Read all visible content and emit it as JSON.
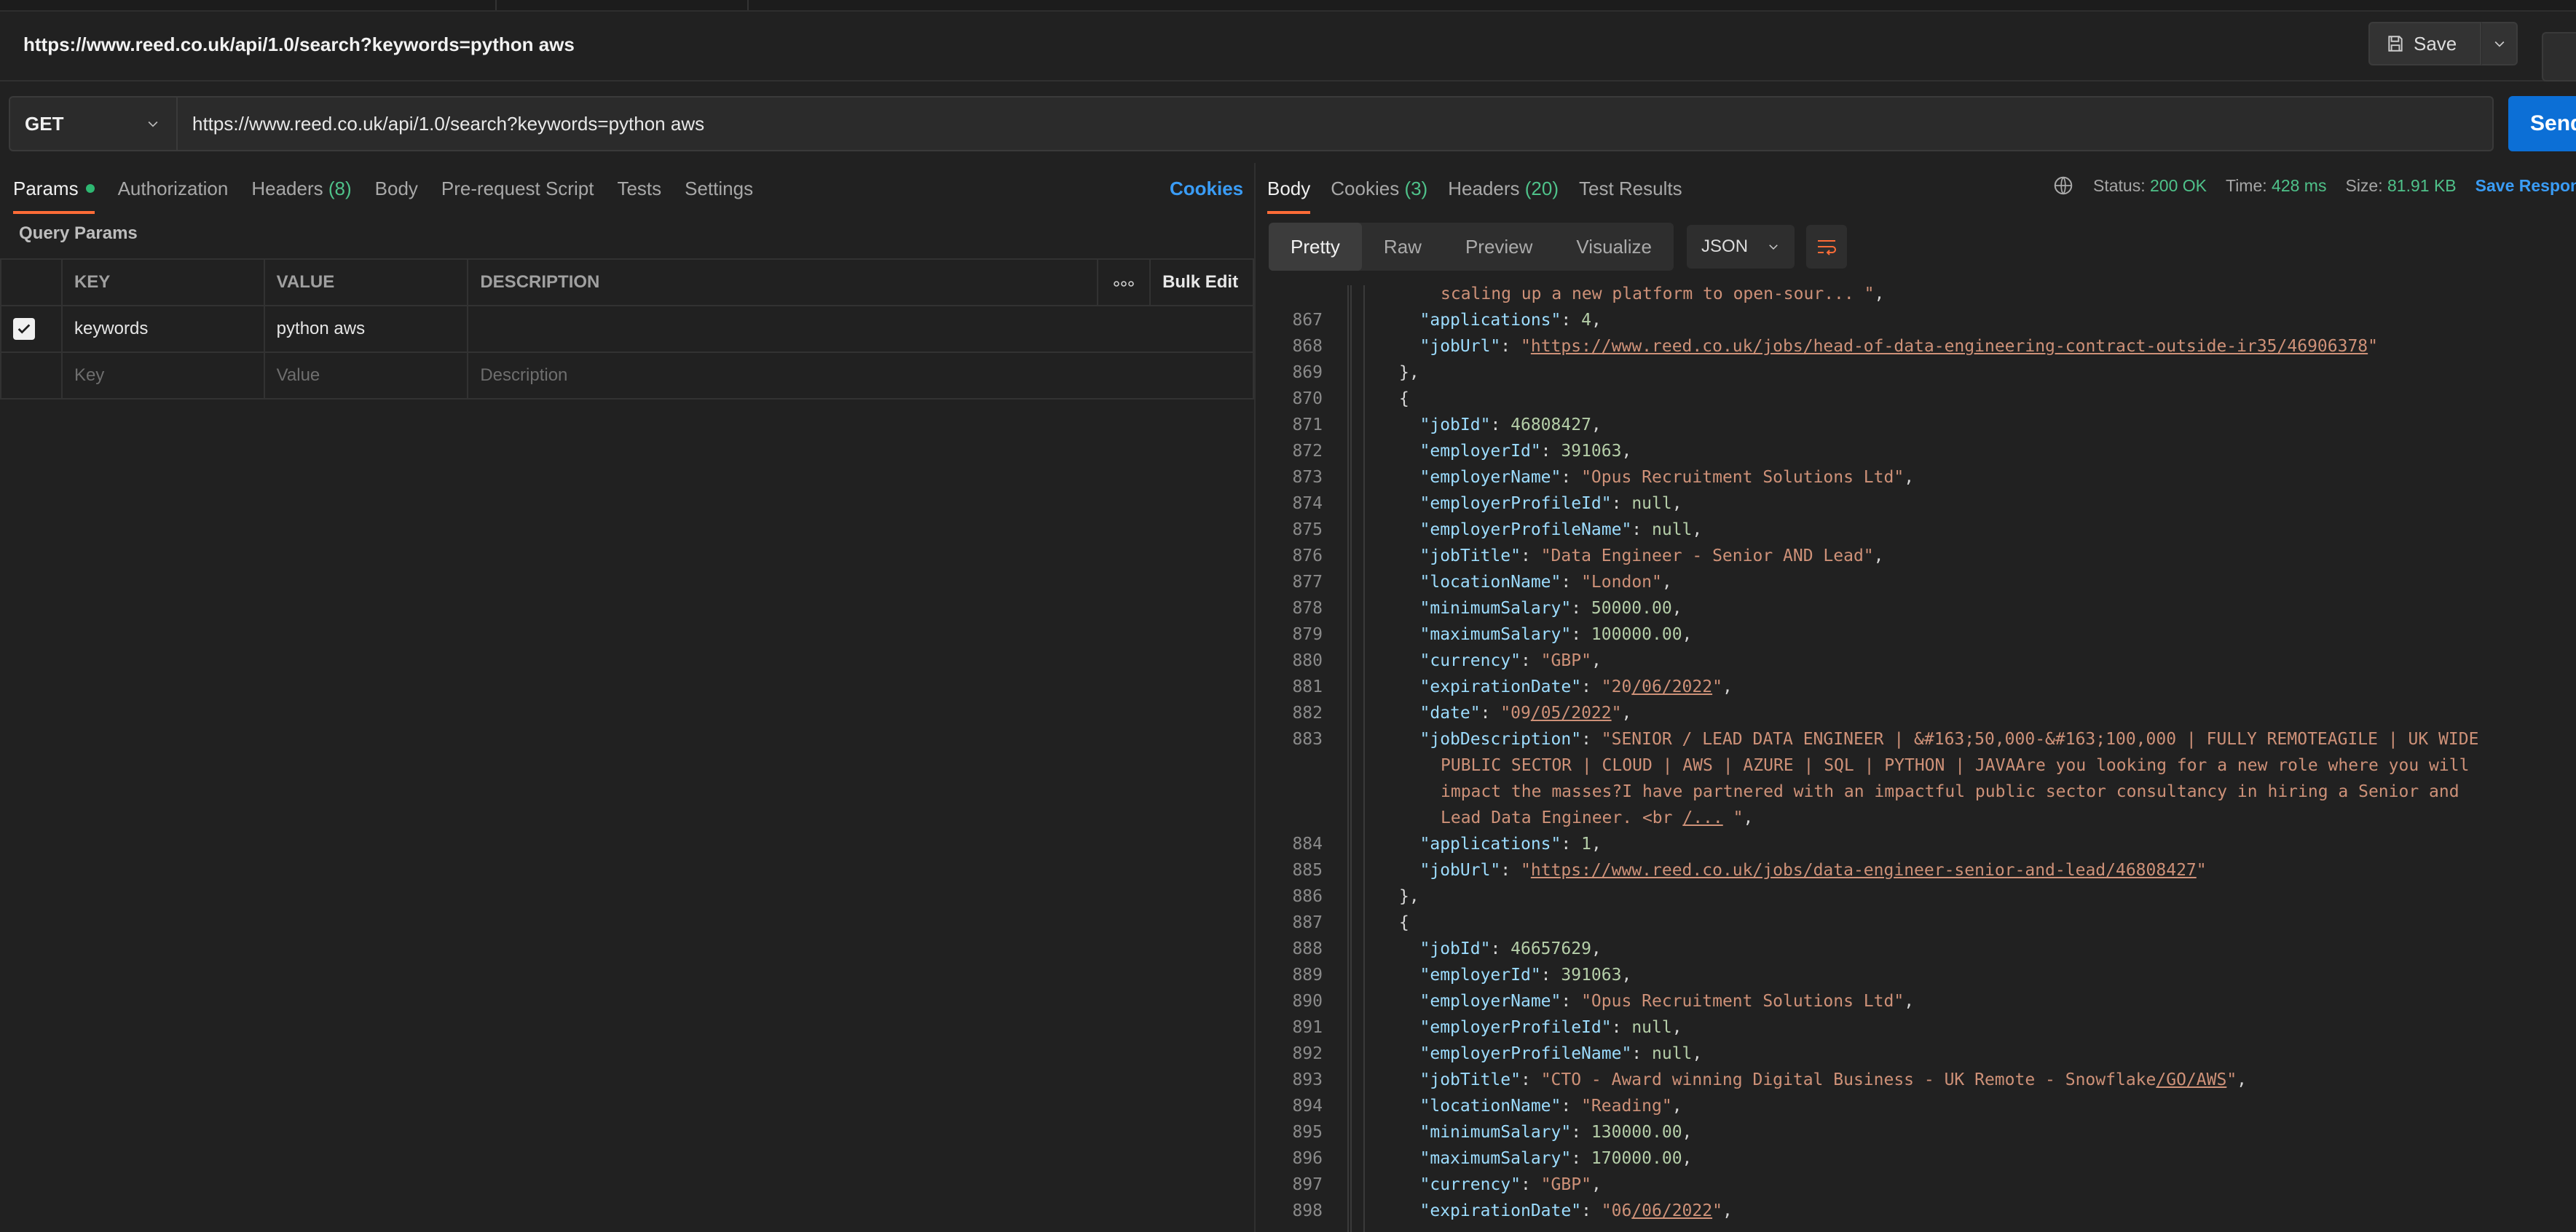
{
  "request": {
    "title": "https://www.reed.co.uk/api/1.0/search?keywords=python aws",
    "save_label": "Save",
    "method": "GET",
    "url": "https://www.reed.co.uk/api/1.0/search?keywords=python aws",
    "send_label": "Send"
  },
  "req_tabs": [
    {
      "label": "Params",
      "count": ""
    },
    {
      "label": "Authorization",
      "count": ""
    },
    {
      "label": "Headers",
      "count": "(8)"
    },
    {
      "label": "Body",
      "count": ""
    },
    {
      "label": "Pre-request Script",
      "count": ""
    },
    {
      "label": "Tests",
      "count": ""
    },
    {
      "label": "Settings",
      "count": ""
    }
  ],
  "cookies_link": "Cookies",
  "query_params": {
    "title": "Query Params",
    "headers": {
      "key": "KEY",
      "value": "VALUE",
      "description": "DESCRIPTION",
      "bulk_edit": "Bulk Edit"
    },
    "rows": [
      {
        "key": "keywords",
        "value": "python aws",
        "description": ""
      }
    ],
    "placeholders": {
      "key": "Key",
      "value": "Value",
      "description": "Description"
    }
  },
  "response": {
    "tabs": [
      {
        "label": "Body",
        "count": ""
      },
      {
        "label": "Cookies",
        "count": "(3)"
      },
      {
        "label": "Headers",
        "count": "(20)"
      },
      {
        "label": "Test Results",
        "count": ""
      }
    ],
    "status_label": "Status:",
    "status": "200 OK",
    "time_label": "Time:",
    "time": "428 ms",
    "size_label": "Size:",
    "size": "81.91 KB",
    "save_response": "Save Response",
    "views": [
      "Pretty",
      "Raw",
      "Preview",
      "Visualize"
    ],
    "format": "JSON"
  },
  "code_lines": [
    {
      "n": "",
      "i": 4,
      "p": [
        {
          "t": "scaling up a new platform to open-sour... \"",
          "c": "s"
        },
        {
          "t": ",",
          "c": ""
        }
      ]
    },
    {
      "n": "867",
      "i": 3,
      "p": [
        {
          "t": "\"applications\"",
          "c": "k"
        },
        {
          "t": ": ",
          "c": ""
        },
        {
          "t": "4",
          "c": "n"
        },
        {
          "t": ",",
          "c": ""
        }
      ]
    },
    {
      "n": "868",
      "i": 3,
      "p": [
        {
          "t": "\"jobUrl\"",
          "c": "k"
        },
        {
          "t": ": ",
          "c": ""
        },
        {
          "t": "\"",
          "c": "s"
        },
        {
          "t": "https://www.reed.co.uk/jobs/head-of-data-engineering-contract-outside-ir35/46906378",
          "c": "u"
        },
        {
          "t": "\"",
          "c": "s"
        }
      ]
    },
    {
      "n": "869",
      "i": 2,
      "p": [
        {
          "t": "},",
          "c": ""
        }
      ]
    },
    {
      "n": "870",
      "i": 2,
      "p": [
        {
          "t": "{",
          "c": ""
        }
      ]
    },
    {
      "n": "871",
      "i": 3,
      "p": [
        {
          "t": "\"jobId\"",
          "c": "k"
        },
        {
          "t": ": ",
          "c": ""
        },
        {
          "t": "46808427",
          "c": "n"
        },
        {
          "t": ",",
          "c": ""
        }
      ]
    },
    {
      "n": "872",
      "i": 3,
      "p": [
        {
          "t": "\"employerId\"",
          "c": "k"
        },
        {
          "t": ": ",
          "c": ""
        },
        {
          "t": "391063",
          "c": "n"
        },
        {
          "t": ",",
          "c": ""
        }
      ]
    },
    {
      "n": "873",
      "i": 3,
      "p": [
        {
          "t": "\"employerName\"",
          "c": "k"
        },
        {
          "t": ": ",
          "c": ""
        },
        {
          "t": "\"Opus Recruitment Solutions Ltd\"",
          "c": "s"
        },
        {
          "t": ",",
          "c": ""
        }
      ]
    },
    {
      "n": "874",
      "i": 3,
      "p": [
        {
          "t": "\"employerProfileId\"",
          "c": "k"
        },
        {
          "t": ": ",
          "c": ""
        },
        {
          "t": "null",
          "c": "n"
        },
        {
          "t": ",",
          "c": ""
        }
      ]
    },
    {
      "n": "875",
      "i": 3,
      "p": [
        {
          "t": "\"employerProfileName\"",
          "c": "k"
        },
        {
          "t": ": ",
          "c": ""
        },
        {
          "t": "null",
          "c": "n"
        },
        {
          "t": ",",
          "c": ""
        }
      ]
    },
    {
      "n": "876",
      "i": 3,
      "p": [
        {
          "t": "\"jobTitle\"",
          "c": "k"
        },
        {
          "t": ": ",
          "c": ""
        },
        {
          "t": "\"Data Engineer - Senior AND Lead\"",
          "c": "s"
        },
        {
          "t": ",",
          "c": ""
        }
      ]
    },
    {
      "n": "877",
      "i": 3,
      "p": [
        {
          "t": "\"locationName\"",
          "c": "k"
        },
        {
          "t": ": ",
          "c": ""
        },
        {
          "t": "\"London\"",
          "c": "s"
        },
        {
          "t": ",",
          "c": ""
        }
      ]
    },
    {
      "n": "878",
      "i": 3,
      "p": [
        {
          "t": "\"minimumSalary\"",
          "c": "k"
        },
        {
          "t": ": ",
          "c": ""
        },
        {
          "t": "50000.00",
          "c": "n"
        },
        {
          "t": ",",
          "c": ""
        }
      ]
    },
    {
      "n": "879",
      "i": 3,
      "p": [
        {
          "t": "\"maximumSalary\"",
          "c": "k"
        },
        {
          "t": ": ",
          "c": ""
        },
        {
          "t": "100000.00",
          "c": "n"
        },
        {
          "t": ",",
          "c": ""
        }
      ]
    },
    {
      "n": "880",
      "i": 3,
      "p": [
        {
          "t": "\"currency\"",
          "c": "k"
        },
        {
          "t": ": ",
          "c": ""
        },
        {
          "t": "\"GBP\"",
          "c": "s"
        },
        {
          "t": ",",
          "c": ""
        }
      ]
    },
    {
      "n": "881",
      "i": 3,
      "p": [
        {
          "t": "\"expirationDate\"",
          "c": "k"
        },
        {
          "t": ": ",
          "c": ""
        },
        {
          "t": "\"20",
          "c": "s"
        },
        {
          "t": "/06/2022",
          "c": "u"
        },
        {
          "t": "\"",
          "c": "s"
        },
        {
          "t": ",",
          "c": ""
        }
      ]
    },
    {
      "n": "882",
      "i": 3,
      "p": [
        {
          "t": "\"date\"",
          "c": "k"
        },
        {
          "t": ": ",
          "c": ""
        },
        {
          "t": "\"09",
          "c": "s"
        },
        {
          "t": "/05/2022",
          "c": "u"
        },
        {
          "t": "\"",
          "c": "s"
        },
        {
          "t": ",",
          "c": ""
        }
      ]
    },
    {
      "n": "883",
      "i": 3,
      "p": [
        {
          "t": "\"jobDescription\"",
          "c": "k"
        },
        {
          "t": ": ",
          "c": ""
        },
        {
          "t": "\"SENIOR / LEAD DATA ENGINEER | &#163;50,000-&#163;100,000 | FULLY REMOTEAGILE | UK WIDE",
          "c": "s"
        }
      ]
    },
    {
      "n": "",
      "i": 4,
      "p": [
        {
          "t": "PUBLIC SECTOR | CLOUD | AWS | AZURE | SQL | PYTHON | JAVAAre you looking for a new role where you will",
          "c": "s"
        }
      ]
    },
    {
      "n": "",
      "i": 4,
      "p": [
        {
          "t": "impact the masses?I have partnered with an impactful public sector consultancy in hiring a Senior and",
          "c": "s"
        }
      ]
    },
    {
      "n": "",
      "i": 4,
      "p": [
        {
          "t": "Lead Data Engineer. <br ",
          "c": "s"
        },
        {
          "t": "/...",
          "c": "u"
        },
        {
          "t": " \"",
          "c": "s"
        },
        {
          "t": ",",
          "c": ""
        }
      ]
    },
    {
      "n": "884",
      "i": 3,
      "p": [
        {
          "t": "\"applications\"",
          "c": "k"
        },
        {
          "t": ": ",
          "c": ""
        },
        {
          "t": "1",
          "c": "n"
        },
        {
          "t": ",",
          "c": ""
        }
      ]
    },
    {
      "n": "885",
      "i": 3,
      "p": [
        {
          "t": "\"jobUrl\"",
          "c": "k"
        },
        {
          "t": ": ",
          "c": ""
        },
        {
          "t": "\"",
          "c": "s"
        },
        {
          "t": "https://www.reed.co.uk/jobs/data-engineer-senior-and-lead/46808427",
          "c": "u"
        },
        {
          "t": "\"",
          "c": "s"
        }
      ]
    },
    {
      "n": "886",
      "i": 2,
      "p": [
        {
          "t": "},",
          "c": ""
        }
      ]
    },
    {
      "n": "887",
      "i": 2,
      "p": [
        {
          "t": "{",
          "c": ""
        }
      ]
    },
    {
      "n": "888",
      "i": 3,
      "p": [
        {
          "t": "\"jobId\"",
          "c": "k"
        },
        {
          "t": ": ",
          "c": ""
        },
        {
          "t": "46657629",
          "c": "n"
        },
        {
          "t": ",",
          "c": ""
        }
      ]
    },
    {
      "n": "889",
      "i": 3,
      "p": [
        {
          "t": "\"employerId\"",
          "c": "k"
        },
        {
          "t": ": ",
          "c": ""
        },
        {
          "t": "391063",
          "c": "n"
        },
        {
          "t": ",",
          "c": ""
        }
      ]
    },
    {
      "n": "890",
      "i": 3,
      "p": [
        {
          "t": "\"employerName\"",
          "c": "k"
        },
        {
          "t": ": ",
          "c": ""
        },
        {
          "t": "\"Opus Recruitment Solutions Ltd\"",
          "c": "s"
        },
        {
          "t": ",",
          "c": ""
        }
      ]
    },
    {
      "n": "891",
      "i": 3,
      "p": [
        {
          "t": "\"employerProfileId\"",
          "c": "k"
        },
        {
          "t": ": ",
          "c": ""
        },
        {
          "t": "null",
          "c": "n"
        },
        {
          "t": ",",
          "c": ""
        }
      ]
    },
    {
      "n": "892",
      "i": 3,
      "p": [
        {
          "t": "\"employerProfileName\"",
          "c": "k"
        },
        {
          "t": ": ",
          "c": ""
        },
        {
          "t": "null",
          "c": "n"
        },
        {
          "t": ",",
          "c": ""
        }
      ]
    },
    {
      "n": "893",
      "i": 3,
      "p": [
        {
          "t": "\"jobTitle\"",
          "c": "k"
        },
        {
          "t": ": ",
          "c": ""
        },
        {
          "t": "\"CTO - Award winning Digital Business - UK Remote - Snowflake",
          "c": "s"
        },
        {
          "t": "/GO/AWS",
          "c": "u"
        },
        {
          "t": "\"",
          "c": "s"
        },
        {
          "t": ",",
          "c": ""
        }
      ]
    },
    {
      "n": "894",
      "i": 3,
      "p": [
        {
          "t": "\"locationName\"",
          "c": "k"
        },
        {
          "t": ": ",
          "c": ""
        },
        {
          "t": "\"Reading\"",
          "c": "s"
        },
        {
          "t": ",",
          "c": ""
        }
      ]
    },
    {
      "n": "895",
      "i": 3,
      "p": [
        {
          "t": "\"minimumSalary\"",
          "c": "k"
        },
        {
          "t": ": ",
          "c": ""
        },
        {
          "t": "130000.00",
          "c": "n"
        },
        {
          "t": ",",
          "c": ""
        }
      ]
    },
    {
      "n": "896",
      "i": 3,
      "p": [
        {
          "t": "\"maximumSalary\"",
          "c": "k"
        },
        {
          "t": ": ",
          "c": ""
        },
        {
          "t": "170000.00",
          "c": "n"
        },
        {
          "t": ",",
          "c": ""
        }
      ]
    },
    {
      "n": "897",
      "i": 3,
      "p": [
        {
          "t": "\"currency\"",
          "c": "k"
        },
        {
          "t": ": ",
          "c": ""
        },
        {
          "t": "\"GBP\"",
          "c": "s"
        },
        {
          "t": ",",
          "c": ""
        }
      ]
    },
    {
      "n": "898",
      "i": 3,
      "p": [
        {
          "t": "\"expirationDate\"",
          "c": "k"
        },
        {
          "t": ": ",
          "c": ""
        },
        {
          "t": "\"06",
          "c": "s"
        },
        {
          "t": "/06/2022",
          "c": "u"
        },
        {
          "t": "\"",
          "c": "s"
        },
        {
          "t": ",",
          "c": ""
        }
      ]
    }
  ],
  "colors": {
    "accent": "#ff6c37",
    "send": "#0c6fd6",
    "link": "#3a9cf5",
    "status_ok": "#4fc28a"
  },
  "icons": [
    "save-icon",
    "chevron-down-icon",
    "more-horizontal-icon",
    "checkbox-checked-icon",
    "network-globe-icon",
    "wrap-lines-icon"
  ]
}
